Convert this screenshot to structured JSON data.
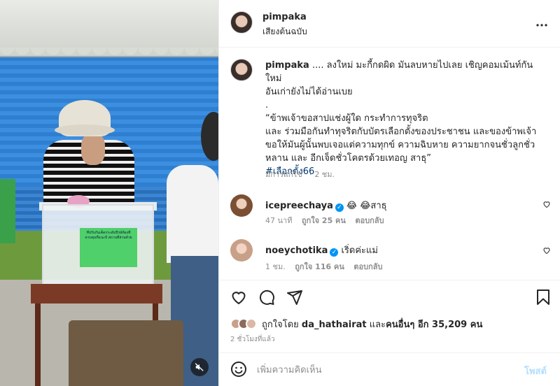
{
  "post_author": {
    "username": "pimpaka",
    "audio": "เสียงต้นฉบับ"
  },
  "caption": {
    "username": "pimpaka",
    "text_1": ".... ลงใหม่ มะกี้กดผิด มันลบหายไปเลย เชิญคอมเม้นท์กันใหม่",
    "text_2": "อันเก่ายังไม่ได้อ่านเบย",
    "text_3": ".",
    "text_4": "“ข้าพเจ้าขอสาปแช่งผู้ใด กระทำการทุจริต",
    "text_5": "และ ร่วมมือกันทำทุจริตกับบัตรเลือกตั้งของประชาชน และของข้าพเจ้า",
    "text_6": "ขอให้มันผู้นั้นพบเจอแต่ความทุกข์ ความฉิบหาย ความยากจนชั่วลูกชั่ว",
    "text_7": "หลาน และ อีกเจ็ดชั่วโคตรด้วยเทอญ สาธุ”",
    "hashtag": "#เลือกตั้ง66",
    "edited": "มีการแก้ไข",
    "time": "2 ชม."
  },
  "comments": [
    {
      "username": "icepreechaya",
      "text": "😂 😂สาธุ",
      "time": "47 นาที",
      "likes": "ถูกใจ 25 คน",
      "reply": "ตอบกลับ"
    },
    {
      "username": "noeychotika",
      "text": "เริ่ดค่ะแม่",
      "time": "1 ชม.",
      "likes": "ถูกใจ 116 คน",
      "reply": "ตอบกลับ"
    }
  ],
  "likes": {
    "prefix": "ถูกใจโดย",
    "user": "da_hathairat",
    "middle": "และ",
    "others": "คนอื่นๆ อีก 35,209 คน"
  },
  "time_ago": "2 ชั่วโมงที่แล้ว",
  "comment_box": {
    "placeholder": "เพิ่มความคิดเห็น",
    "post_label": "โพสต์"
  },
  "photo_label_text": "ที่ปรับกับเต็ดกระดับปีรษ์ท้องที่ควบคุมที่แนะบี สถานที่ส่วนด้วย",
  "colors": {
    "link_blue": "#00376b",
    "verified_blue": "#0095f6",
    "post_disabled": "#b2dffc",
    "muted_text": "#8e8e8e"
  },
  "icons": [
    "heart-icon",
    "comment-icon",
    "share-icon",
    "bookmark-icon",
    "emoji-icon",
    "more-icon",
    "mute-icon",
    "verified-icon"
  ]
}
